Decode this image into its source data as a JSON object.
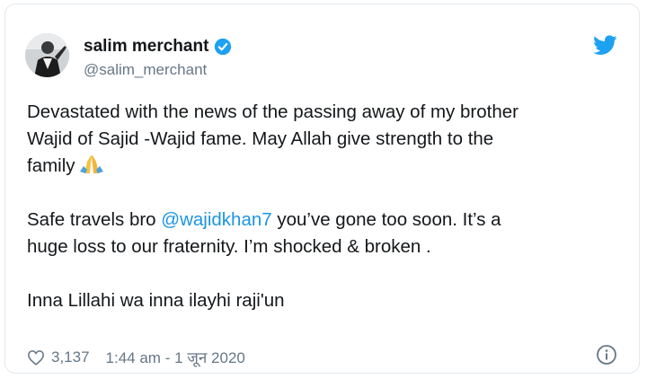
{
  "user": {
    "name": "salim merchant",
    "handle": "@salim_merchant"
  },
  "tweet": {
    "line1": "Devastated with the news of the passing away of my brother",
    "line2": "Wajid of Sajid -Wajid fame. May Allah give strength to the",
    "line3": "family",
    "para2_pre": "Safe travels bro ",
    "mention": "@wajidkhan7",
    "para2_post": " you’ve gone too soon. It’s a",
    "para2_line2": "huge loss to our fraternity. I’m shocked & broken .",
    "para3": "Inna Lillahi wa inna ilayhi raji'un"
  },
  "footer": {
    "likes": "3,137",
    "timestamp": "1:44 am - 1 जून 2020"
  },
  "icons": {
    "verified": "verified-badge-icon",
    "twitter": "twitter-bird-icon",
    "heart": "heart-icon",
    "info": "info-icon",
    "emoji": "folded-hands-emoji"
  },
  "colors": {
    "twitter_blue": "#1da1f2",
    "mention": "#1b95e0",
    "muted": "#657786"
  }
}
